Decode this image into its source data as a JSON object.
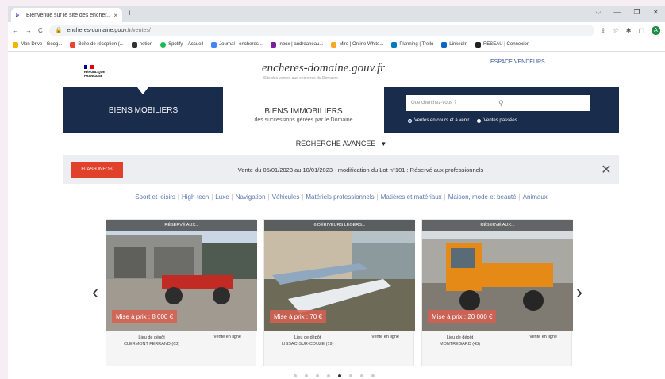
{
  "browser": {
    "tab_title": "Bienvenue sur le site des enchèr...",
    "tab_close": "×",
    "new_tab": "+",
    "window_controls": [
      "⌵",
      "—",
      "❐",
      "✕"
    ],
    "url_domain": "encheres-domaine.gouv.fr",
    "url_path": "/ventes/",
    "avatar_letter": "A",
    "bookmarks": [
      {
        "label": "Mon Drive - Goog...",
        "color": "#f4b400"
      },
      {
        "label": "Boîte de réception (...",
        "color": "#ea4335"
      },
      {
        "label": "notion",
        "color": "#333333"
      },
      {
        "label": "Spotify – Accueil",
        "color": "#1db954"
      },
      {
        "label": "Journal - encheres...",
        "color": "#4285f4"
      },
      {
        "label": "Inbox | andreaneau...",
        "color": "#7b1fa2"
      },
      {
        "label": "Miro | Online White...",
        "color": "#f9a825"
      },
      {
        "label": "Planning | Trello",
        "color": "#0079bf"
      },
      {
        "label": "LinkedIn",
        "color": "#0a66c2"
      },
      {
        "label": "RESEAU | Connexion",
        "color": "#222222"
      }
    ]
  },
  "header": {
    "rf_logo_text": "RÉPUBLIQUE FRANÇAISE",
    "site_title": "encheres-domaine.gouv.fr",
    "site_subtitle": "Site des ventes aux enchères du Domaine",
    "espace_vendeurs": "ESPACE VENDEURS"
  },
  "nav": {
    "biens_mobiliers": "BIENS MOBILIERS",
    "biens_immobiliers": "BIENS IMMOBILIERS",
    "biens_immobiliers_sub": "des successions gérées par le Domaine",
    "search_placeholder": "Que cherchez-vous ?",
    "radio_current": "Ventes en cours et à venir",
    "radio_past": "Ventes passées"
  },
  "advanced_search": "RECHERCHE AVANCÉE",
  "flash": {
    "badge": "FLASH INFOS",
    "message": "Vente du 05/01/2023 au 10/01/2023 - modification du Lot n°101 : Réservé aux professionnels",
    "close": "✕"
  },
  "categories": [
    "Sport et loisirs",
    "High-tech",
    "Luxe",
    "Navigation",
    "Véhicules",
    "Matériels professionnels",
    "Matières et matériaux",
    "Maison, mode et beauté",
    "Animaux"
  ],
  "cards": [
    {
      "banner": "RÉSERVÉ AUX...",
      "price": "Mise à prix : 8 000 €",
      "lieu_label": "Lieu de dépôt",
      "lieu": "CLERMONT FERRAND (63)",
      "mode": "Vente en ligne"
    },
    {
      "banner": "6 DÉRIVEURS LÉGERS...",
      "price": "Mise à prix : 70 €",
      "lieu_label": "Lieu de dépôt",
      "lieu": "LISSAC-SUR-COUZE (19)",
      "mode": "Vente en ligne"
    },
    {
      "banner": "RÉSERVÉ AUX...",
      "price": "Mise à prix : 20 000 €",
      "lieu_label": "Lieu de dépôt",
      "lieu": "MONTREGARD (43)",
      "mode": "Vente en ligne"
    }
  ],
  "carousel": {
    "prev": "‹",
    "next": "›",
    "dot_count": 8,
    "active_dot": 4
  }
}
